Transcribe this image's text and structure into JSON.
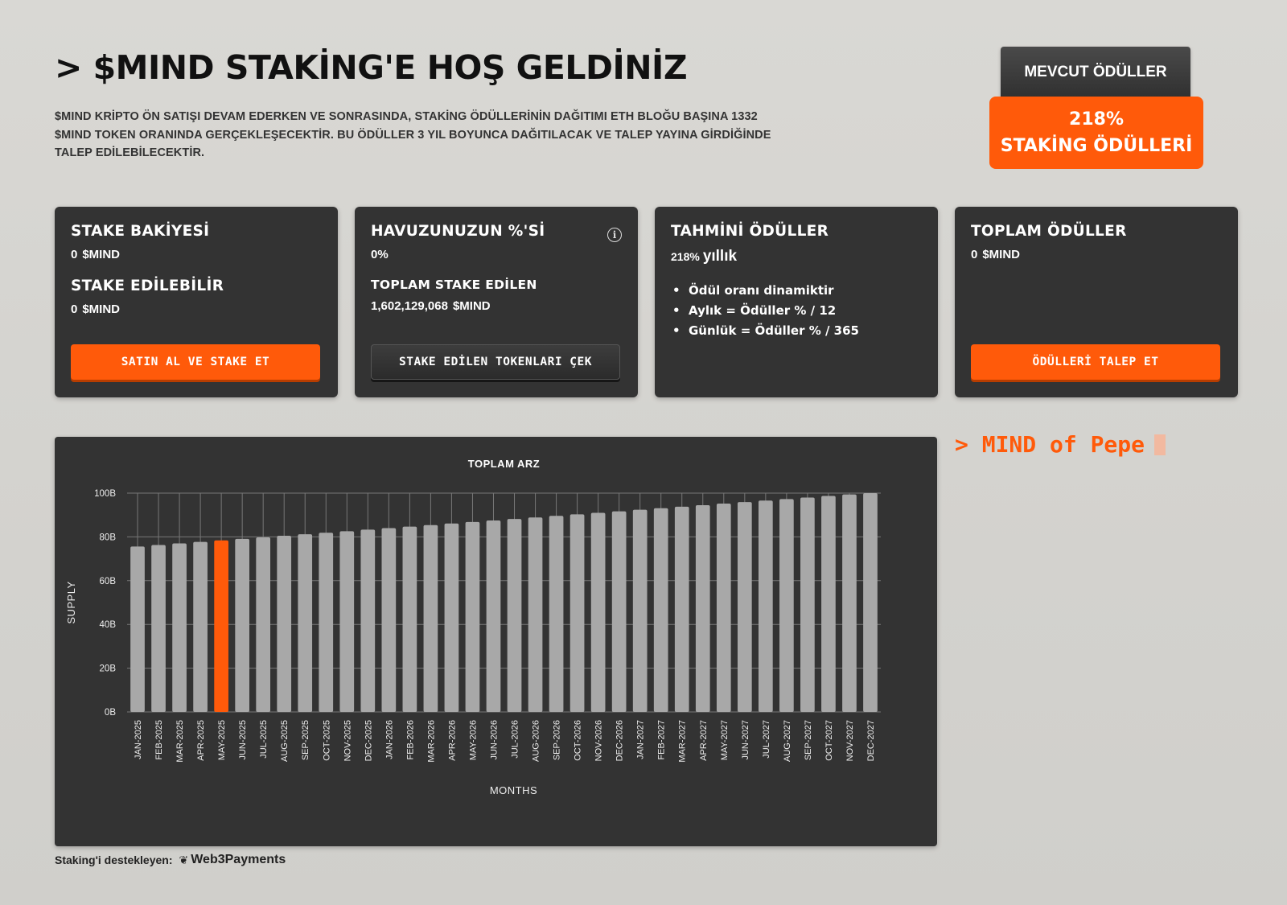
{
  "header": {
    "title": "> $MIND STAKİNG'E HOŞ GELDİNİZ",
    "intro_line1": "$MIND KRİPTO ÖN SATIŞI DEVAM EDERKEN VE SONRASINDA, STAKİNG ÖDÜLLERİNİN DAĞITIMI ETH BLOĞU BAŞINA 1332",
    "intro_line2": "$MIND TOKEN ORANINDA GERÇEKLEŞECEKTİR. BU ÖDÜLLER 3 YIL BOYUNCA DAĞITILACAK VE TALEP YAYINA GİRDİĞİNDE",
    "intro_line3": "TALEP EDİLEBİLECEKTİR."
  },
  "rewards_badge": {
    "tab_label": "MEVCUT ÖDÜLLER",
    "percent": "218%",
    "label": "STAKİNG ÖDÜLLERİ"
  },
  "cards": {
    "balance": {
      "title": "STAKE BAKİYESİ",
      "amount": "0",
      "unit": "$MIND",
      "stakeable_title": "STAKE EDİLEBİLİR",
      "stakeable_amount": "0",
      "stakeable_unit": "$MIND",
      "button": "SATIN AL VE STAKE ET"
    },
    "pool": {
      "title": "HAVUZUNUZUN %'Sİ",
      "percent": "0%",
      "total_title": "TOPLAM STAKE EDİLEN",
      "total_amount": "1,602,129,068",
      "total_unit": "$MIND",
      "button": "STAKE EDİLEN TOKENLARI ÇEK",
      "info_symbol": "i"
    },
    "estimated": {
      "title": "TAHMİNİ ÖDÜLLER",
      "rate": "218%",
      "rate_word": "yıllık",
      "bullets": [
        "Ödül oranı dinamiktir",
        "Aylık = Ödüller % / 12",
        "Günlük = Ödüller % / 365"
      ]
    },
    "total": {
      "title": "TOPLAM ÖDÜLLER",
      "amount": "0",
      "unit": "$MIND",
      "button": "ÖDÜLLERİ TALEP ET"
    }
  },
  "terminal": {
    "text": "> MIND of Pepe"
  },
  "footer": {
    "powered_by": "Staking'i destekleyen:",
    "brand": "Web3Payments",
    "brand_icon": "❦"
  },
  "chart_data": {
    "type": "bar",
    "title": "TOPLAM ARZ",
    "xlabel": "MONTHS",
    "ylabel": "SUPPLY",
    "ylim": [
      0,
      100
    ],
    "yticks": [
      "0B",
      "20B",
      "40B",
      "60B",
      "80B",
      "100B"
    ],
    "grid": true,
    "highlight_index": 4,
    "bar_color": "#a8a8a8",
    "highlight_color": "#ff5a0a",
    "categories": [
      "JAN-2025",
      "FEB-2025",
      "MAR-2025",
      "APR-2025",
      "MAY-2025",
      "JUN-2025",
      "JUL-2025",
      "AUG-2025",
      "SEP-2025",
      "OCT-2025",
      "NOV-2025",
      "DEC-2025",
      "JAN-2026",
      "FEB-2026",
      "MAR-2026",
      "APR-2026",
      "MAY-2026",
      "JUN-2026",
      "JUL-2026",
      "AUG-2026",
      "SEP-2026",
      "OCT-2026",
      "NOV-2026",
      "DEC-2026",
      "JAN-2027",
      "FEB-2027",
      "MAR-2027",
      "APR-2027",
      "MAY-2027",
      "JUN-2027",
      "JUL-2027",
      "AUG-2027",
      "SEP-2027",
      "OCT-2027",
      "NOV-2027",
      "DEC-2027"
    ],
    "values": [
      75.6,
      76.3,
      77.0,
      77.7,
      78.4,
      79.1,
      79.8,
      80.5,
      81.2,
      81.9,
      82.6,
      83.3,
      84.0,
      84.7,
      85.4,
      86.1,
      86.8,
      87.5,
      88.2,
      88.9,
      89.6,
      90.3,
      91.0,
      91.7,
      92.4,
      93.1,
      93.8,
      94.5,
      95.2,
      95.9,
      96.6,
      97.3,
      98.0,
      98.7,
      99.4,
      100.0
    ]
  }
}
